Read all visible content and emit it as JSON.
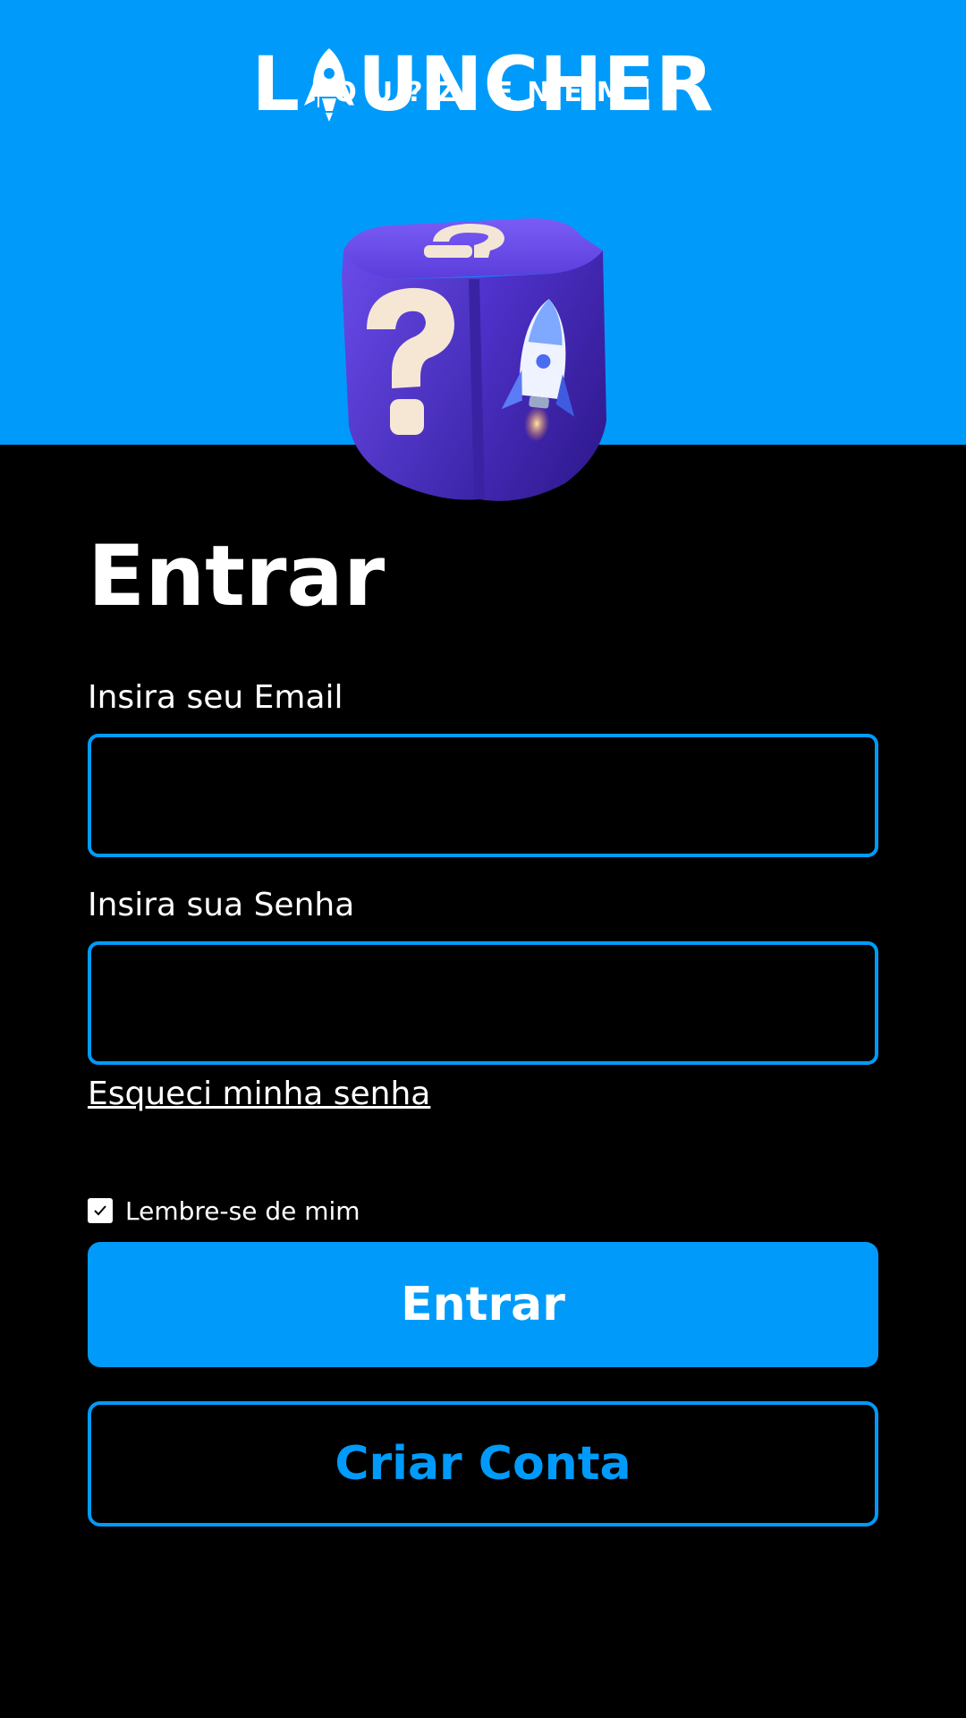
{
  "colors": {
    "brand_blue": "#009BFA",
    "background": "#000000",
    "text": "#FFFFFF",
    "cube_purple": "#4A2FC4"
  },
  "logo": {
    "word_before": "L",
    "word_after": "UNCHER",
    "rocket_icon": "rocket-icon",
    "subtitle": "QU?Z ENEM",
    "alt": "LAUNCHER"
  },
  "hero_image": {
    "icon": "question-rocket-cube"
  },
  "form": {
    "title": "Entrar",
    "email_label": "Insira seu Email",
    "email_value": "",
    "password_label": "Insira sua Senha",
    "password_value": "",
    "forgot_link": "Esqueci minha senha",
    "remember_label": "Lembre-se de mim",
    "remember_checked": true,
    "submit_label": "Entrar",
    "create_account_label": "Criar Conta"
  }
}
